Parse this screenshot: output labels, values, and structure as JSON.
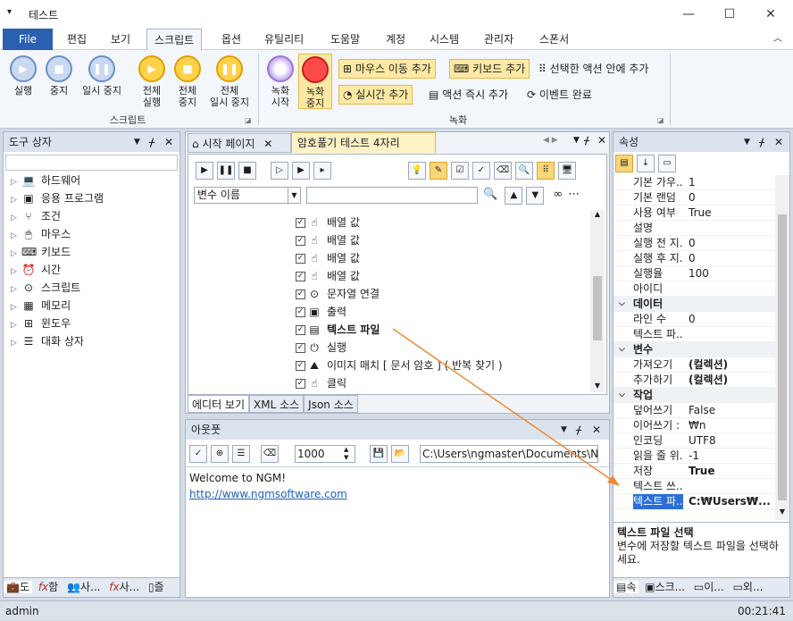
{
  "window": {
    "title": "테스트",
    "menu_glyph": "▾",
    "minimize": "—",
    "maximize": "☐",
    "close": "✕"
  },
  "menu": {
    "items": [
      "File",
      "편집",
      "보기",
      "스크립트",
      "옵션",
      "유틸리티",
      "도움말",
      "계정",
      "시스템",
      "관리자",
      "스폰서"
    ],
    "collapse": "︿"
  },
  "ribbon": {
    "script_group": {
      "buttons": [
        {
          "label1": "실행",
          "label2": "",
          "icon": "play-icon"
        },
        {
          "label1": "중지",
          "label2": "",
          "icon": "stop-icon"
        },
        {
          "label1": "일시 중지",
          "label2": "",
          "icon": "pause-icon"
        },
        {
          "label1": "전체",
          "label2": "실행",
          "icon": "play-all-icon"
        },
        {
          "label1": "전체",
          "label2": "중지",
          "icon": "stop-all-icon"
        },
        {
          "label1": "전체",
          "label2": "일시 중지",
          "icon": "pause-all-icon"
        }
      ],
      "label": "스크립트"
    },
    "record_group": {
      "start": {
        "label1": "녹화",
        "label2": "시작"
      },
      "stop": {
        "label1": "녹화",
        "label2": "중지"
      },
      "mouse_move": "마우스 이동 추가",
      "keyboard": "키보드 추가",
      "in_selected": "선택한 액션 안에 추가",
      "realtime": "실시간 추가",
      "immediate": "액션 즉시 추가",
      "event_done": "이벤트 완료",
      "label": "녹화"
    }
  },
  "toolbox": {
    "title": "도구 상자",
    "items": [
      {
        "label": "하드웨어",
        "icon": "hardware-icon"
      },
      {
        "label": "응용 프로그램",
        "icon": "application-icon"
      },
      {
        "label": "조건",
        "icon": "condition-icon"
      },
      {
        "label": "마우스",
        "icon": "mouse-icon"
      },
      {
        "label": "키보드",
        "icon": "keyboard-icon"
      },
      {
        "label": "시간",
        "icon": "clock-icon"
      },
      {
        "label": "스크립트",
        "icon": "script-icon"
      },
      {
        "label": "메모리",
        "icon": "memory-icon"
      },
      {
        "label": "윈도우",
        "icon": "window-icon"
      },
      {
        "label": "대화 상자",
        "icon": "dialog-icon"
      }
    ],
    "bottom_tabs": [
      "도",
      "함",
      "사...",
      "사...",
      "즐"
    ]
  },
  "editor": {
    "tabs": [
      {
        "label": "시작 페이지"
      },
      {
        "label": "암호풀기 테스트 4자리"
      }
    ],
    "variable_select": "변수 이름",
    "rows": [
      {
        "label": "배열 값",
        "icon": "click-icon"
      },
      {
        "label": "배열 값",
        "icon": "click-icon"
      },
      {
        "label": "배열 값",
        "icon": "click-icon"
      },
      {
        "label": "배열 값",
        "icon": "click-icon"
      },
      {
        "label": "문자열 연결",
        "icon": "ellipsis-icon"
      },
      {
        "label": "출력",
        "icon": "console-icon"
      },
      {
        "label": "텍스트 파일",
        "icon": "text-file-icon"
      },
      {
        "label": "실행",
        "icon": "run-icon"
      },
      {
        "label": "이미지 매치 [ 문서 암호 ] ( 반복 찾기 )",
        "icon": "image-match-icon"
      },
      {
        "label": "클릭",
        "icon": "click-icon"
      }
    ],
    "bottom_tabs": [
      "에디터 보기",
      "XML 소스",
      "Json 소스"
    ]
  },
  "output": {
    "title": "아웃풋",
    "number": "1000",
    "path": "C:\\Users\\ngmaster\\Documents\\NGM",
    "lines": [
      "Welcome to NGM!",
      "http://www.ngmsoftware.com"
    ]
  },
  "properties": {
    "title": "속성",
    "rows": [
      {
        "k": "기본 가우...",
        "v": "1",
        "cat": false,
        "bold": false
      },
      {
        "k": "기본 랜덤",
        "v": "0",
        "cat": false,
        "bold": false
      },
      {
        "k": "사용 여부",
        "v": "True",
        "cat": false,
        "bold": false
      },
      {
        "k": "설명",
        "v": "",
        "cat": false,
        "bold": false
      },
      {
        "k": "실행 전 지...",
        "v": "0",
        "cat": false,
        "bold": false
      },
      {
        "k": "실행 후 지...",
        "v": "0",
        "cat": false,
        "bold": false
      },
      {
        "k": "실행율",
        "v": "100",
        "cat": false,
        "bold": false
      },
      {
        "k": "아이디",
        "v": "",
        "cat": false,
        "bold": false
      },
      {
        "k": "데이터",
        "v": "",
        "cat": true,
        "bold": false
      },
      {
        "k": "라인 수",
        "v": "0",
        "cat": false,
        "bold": false
      },
      {
        "k": "텍스트 파...",
        "v": "",
        "cat": false,
        "bold": false
      },
      {
        "k": "변수",
        "v": "",
        "cat": true,
        "bold": false
      },
      {
        "k": "가져오기",
        "v": "(컬렉션)",
        "cat": false,
        "bold": true
      },
      {
        "k": "추가하기",
        "v": "(컬렉션)",
        "cat": false,
        "bold": true
      },
      {
        "k": "작업",
        "v": "",
        "cat": true,
        "bold": false
      },
      {
        "k": "덮어쓰기",
        "v": "False",
        "cat": false,
        "bold": false
      },
      {
        "k": "이어쓰기 :",
        "v": "₩n",
        "cat": false,
        "bold": false
      },
      {
        "k": "인코딩",
        "v": "UTF8",
        "cat": false,
        "bold": false
      },
      {
        "k": "읽을 줄 위...",
        "v": "-1",
        "cat": false,
        "bold": false
      },
      {
        "k": "저장",
        "v": "True",
        "cat": false,
        "bold": true
      },
      {
        "k": "텍스트 쓰...",
        "v": "",
        "cat": false,
        "bold": false
      },
      {
        "k": "텍스트 파...",
        "v": "C:₩Users₩...",
        "cat": false,
        "bold": true
      }
    ],
    "desc_title": "텍스트 파일 선택",
    "desc_text": "변수에 저장할 텍스트 파일을 선택하세요.",
    "bottom_tabs": [
      "속",
      "스크...",
      "이...",
      "외..."
    ]
  },
  "status": {
    "user": "admin",
    "time": "00:21:41"
  }
}
